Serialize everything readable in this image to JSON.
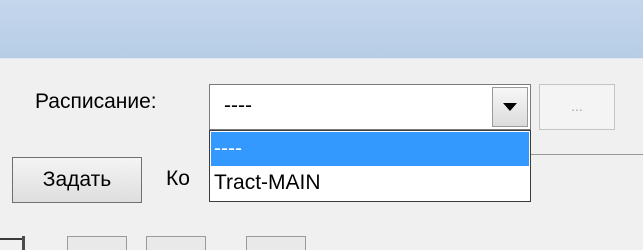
{
  "schedule": {
    "label": "Расписание:",
    "selected_value": "----",
    "ellipsis_label": "...",
    "options": [
      "----",
      "Tract-MAIN"
    ],
    "highlight_color": "#3399ff"
  },
  "actions": {
    "set_button_label": "Задать",
    "partial_label": "Ко"
  },
  "icons": [
    "dropdown-arrow-icon",
    "toolbar-icon"
  ]
}
